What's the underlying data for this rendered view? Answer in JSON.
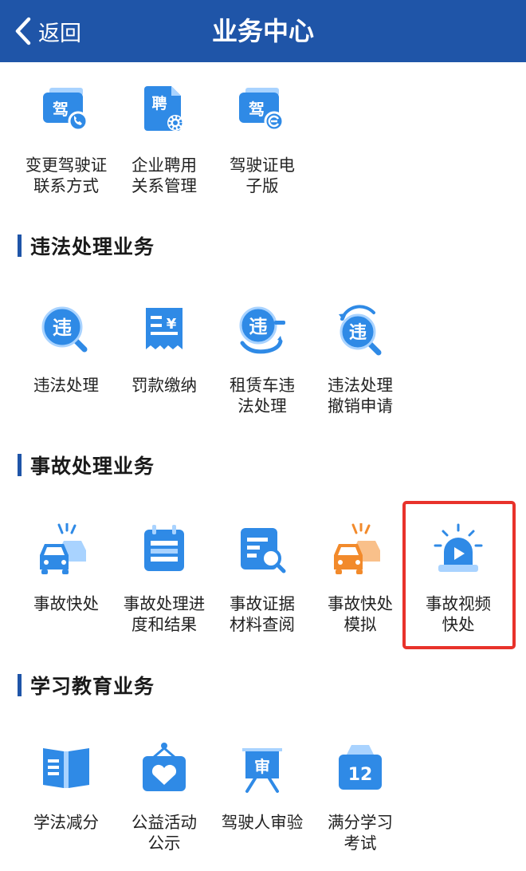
{
  "header": {
    "back_label": "返回",
    "title": "业务中心"
  },
  "rows": [
    {
      "tiles": [
        {
          "label": "变更驾驶证\n联系方式",
          "icon": "license-phone-icon",
          "glyph": "驾"
        },
        {
          "label": "企业聘用\n关系管理",
          "icon": "employ-document-icon",
          "glyph": "聘"
        },
        {
          "label": "驾驶证电\n子版",
          "icon": "electronic-license-icon",
          "glyph": "驾"
        }
      ]
    },
    {
      "tiles": [
        {
          "label": "违法处理",
          "icon": "violation-search-icon",
          "glyph": "违"
        },
        {
          "label": "罚款缴纳",
          "icon": "fine-receipt-icon",
          "glyph": "¥"
        },
        {
          "label": "租赁车违\n法处理",
          "icon": "rental-violation-icon",
          "glyph": "违"
        },
        {
          "label": "违法处理\n撤销申请",
          "icon": "violation-revoke-icon",
          "glyph": "违"
        }
      ]
    },
    {
      "tiles": [
        {
          "label": "事故快处",
          "icon": "car-accident-icon"
        },
        {
          "label": "事故处理进\n度和结果",
          "icon": "accident-progress-icon"
        },
        {
          "label": "事故证据\n材料查阅",
          "icon": "evidence-search-icon"
        },
        {
          "label": "事故快处\n模拟",
          "icon": "accident-simulation-icon"
        },
        {
          "label": "事故视频\n快处",
          "icon": "video-alarm-icon"
        }
      ]
    },
    {
      "tiles": [
        {
          "label": "学法减分",
          "icon": "open-book-icon"
        },
        {
          "label": "公益活动\n公示",
          "icon": "charity-heart-icon"
        },
        {
          "label": "驾驶人审验",
          "icon": "review-easel-icon",
          "glyph": "审"
        },
        {
          "label": "满分学习\n考试",
          "icon": "calendar-exam-icon",
          "glyph": "12"
        }
      ]
    }
  ],
  "sections": [
    {
      "title": "违法处理业务"
    },
    {
      "title": "事故处理业务"
    },
    {
      "title": "学习教育业务"
    }
  ],
  "colors": {
    "header_bg": "#1f55a8",
    "icon_blue": "#2f8ae6",
    "icon_light": "#a9d3ff",
    "icon_orange": "#f28a2b",
    "highlight_border": "#e8322b"
  }
}
